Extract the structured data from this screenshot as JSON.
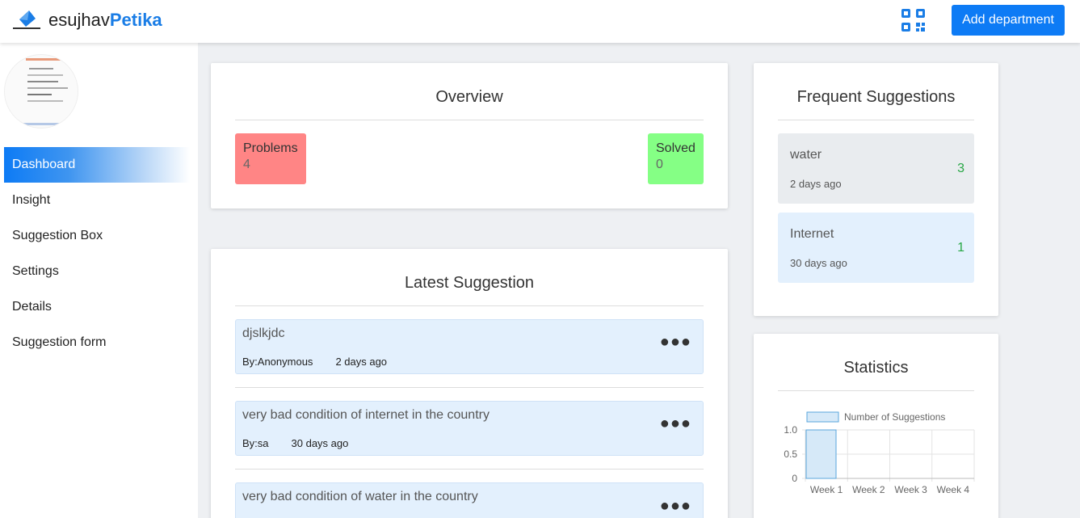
{
  "header": {
    "brand_plain": "esujhav",
    "brand_bold": "Petika",
    "add_department_label": "Add department"
  },
  "sidebar": {
    "items": [
      {
        "label": "Dashboard",
        "active": true
      },
      {
        "label": "Insight"
      },
      {
        "label": "Suggestion Box"
      },
      {
        "label": "Settings"
      },
      {
        "label": "Details"
      },
      {
        "label": "Suggestion form"
      }
    ]
  },
  "overview": {
    "title": "Overview",
    "problems_label": "Problems",
    "problems_count": "4",
    "solved_label": "Solved",
    "solved_count": "0"
  },
  "latest": {
    "title": "Latest Suggestion",
    "items": [
      {
        "text": "djslkjdc",
        "by": "By:Anonymous",
        "time": "2 days ago"
      },
      {
        "text": "very bad condition of internet in the country",
        "by": "By:sa",
        "time": "30 days ago"
      },
      {
        "text": "very bad condition of water in the country",
        "by": "",
        "time": ""
      }
    ]
  },
  "frequent": {
    "title": "Frequent Suggestions",
    "items": [
      {
        "label": "water",
        "time": "2 days ago",
        "count": "3",
        "bg": "#e9ecef"
      },
      {
        "label": "Internet",
        "time": "30 days ago",
        "count": "1",
        "bg": "#e3f0fd"
      }
    ]
  },
  "statistics": {
    "title": "Statistics"
  },
  "chart_data": {
    "type": "bar",
    "categories": [
      "Week 1",
      "Week 2",
      "Week 3",
      "Week 4"
    ],
    "series": [
      {
        "name": "Number of Suggestions",
        "values": [
          1,
          0,
          0,
          0
        ]
      }
    ],
    "yticks": [
      "0",
      "0.5",
      "1.0"
    ],
    "ylim": [
      0,
      1
    ],
    "legend": "top",
    "grid": true
  },
  "colors": {
    "accent": "#0d7bf5",
    "problems": "#ff8585",
    "solved": "#85ff85",
    "count_green": "#28a745",
    "bar_fill": "#d6e9f8",
    "bar_stroke": "#5aa6dc"
  }
}
